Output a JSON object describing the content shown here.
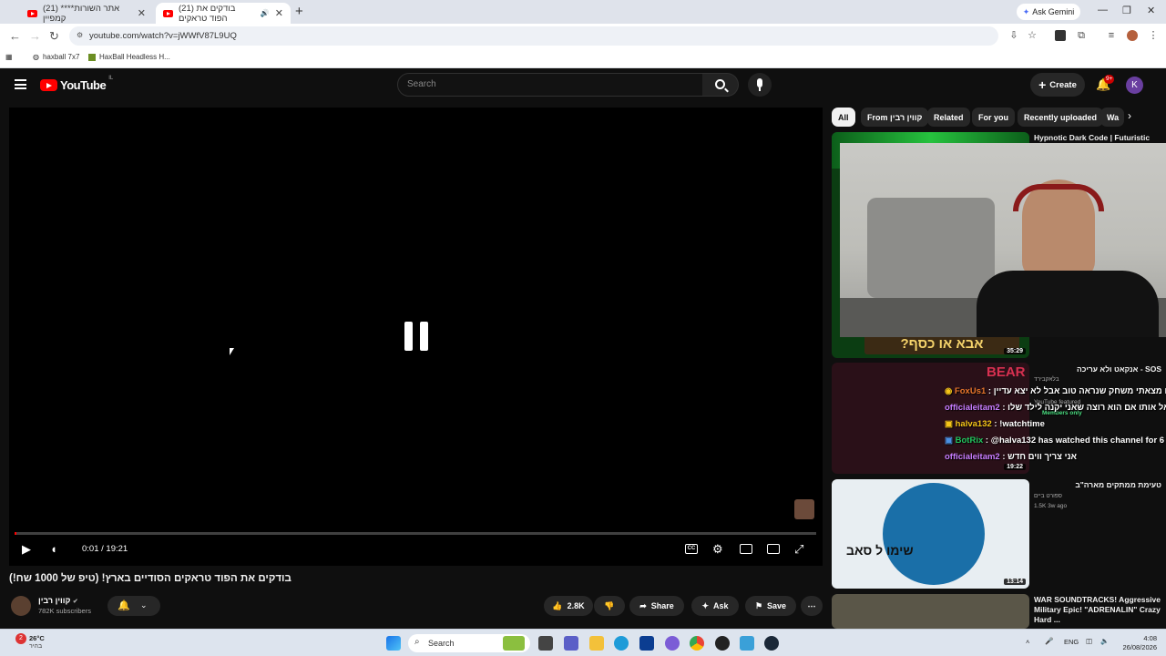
{
  "browser": {
    "tabs": [
      {
        "title": "(21) **אתר השורות** קמפיין",
        "active": false
      },
      {
        "title": "(21) בודקים את הפוד טראקים",
        "active": true
      }
    ],
    "ask_gemini": "Ask Gemini",
    "url": "youtube.com/watch?v=jWWfV87L9UQ",
    "bookmarks": [
      "haxball 7x7",
      "HaxBall Headless H..."
    ]
  },
  "youtube": {
    "logo_text": "YouTube",
    "logo_country": "IL",
    "search_placeholder": "Search",
    "create_label": "Create",
    "notif_count": "9+",
    "avatar_letter": "K"
  },
  "player": {
    "current_time": "0:01",
    "duration": "19:21",
    "time_display": "0:01 / 19:21",
    "progress_fraction": 0.001,
    "state": "paused-indicator"
  },
  "video": {
    "title": "בודקים את הפוד טראקים הסודיים בארץ! (טיפ של 1000 שח!)",
    "channel": "קווין רבין",
    "subscribers": "782K subscribers",
    "likes": "2.8K",
    "share_label": "Share",
    "ask_label": "Ask",
    "save_label": "Save"
  },
  "chips": [
    "All",
    "From קווין רבין",
    "Related",
    "For you",
    "Recently uploaded",
    "Wa"
  ],
  "recommendations": [
    {
      "title": "Hypnotic Dark Code | Futuristic",
      "duration": "35:29",
      "thumb_text": "אבא או כסף?"
    },
    {
      "title": "SOS - אנקאט ולא עריכה",
      "channel": "בלאקבירד",
      "meta": "YouTube featured",
      "duration": "19:22"
    },
    {
      "title": "טעימת ממתקים מארה\"ב",
      "channel": "ספורט ביים",
      "meta": "1.5K  3w ago",
      "duration": "13:14",
      "thumb_text": "שימו ל סאב"
    },
    {
      "title": "WAR SOUNDTRACKS! Aggressive Military Epic! \"ADRENALIN\" Crazy Hard ..."
    }
  ],
  "chat_overlay": [
    {
      "user": "FoxUs1",
      "message": "או מצאתי משחק שנראה טוב אבל לא יצא עדיין",
      "members_only": "Members only"
    },
    {
      "user": "officialeitam2",
      "message": "שאל אותו אם הוא רוצה שאני יקנה לילד שלו"
    },
    {
      "user": "halva132",
      "message": "!watchtime"
    },
    {
      "user": "BotRix",
      "message": "@halva132 has watched this channel for 6"
    },
    {
      "user": "officialeitam2",
      "message": "אני צריך ווים חדש"
    }
  ],
  "taskbar": {
    "weather_temp": "26°C",
    "weather_text": "בהיר",
    "search_label": "Search",
    "lang": "ENG",
    "time": "4:08",
    "date": "26/08/2026",
    "weather_badge": "2"
  }
}
